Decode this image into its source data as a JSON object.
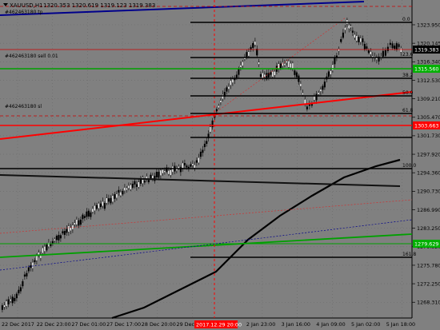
{
  "window": {
    "symbol_label": "XAUUSD,H1",
    "ohlc": "1320.353 1320.619 1319.123 1319.383"
  },
  "colors": {
    "background": "#808080",
    "bull_candle": "#ffffff",
    "bear_candle": "#000000",
    "grid": "#000000",
    "trend_blue": "#00008b",
    "trend_red": "#ff0000",
    "trend_green": "#00a000",
    "fib_line": "#000000",
    "ma_line": "#000000",
    "current_price_bg": "#000000",
    "green_tag_bg": "#00b000",
    "red_tag_bg": "#ff0000"
  },
  "orders": {
    "sell_label": "#462463180 sell 0.01",
    "sl_label": "#462463180 sl",
    "tp_label": "#462463180 tp"
  },
  "price_axis": {
    "ticks": [
      "1323.950",
      "1320.145",
      "1316.340",
      "1312.530",
      "1309.210",
      "1305.470",
      "1301.730",
      "1297.920",
      "1294.360",
      "1290.730",
      "1286.990",
      "1283.250",
      "1279.520",
      "1275.780",
      "1272.250",
      "1268.310"
    ],
    "current_price": "1319.383",
    "green_level": "1315.560",
    "red_level": "1303.663",
    "green_level_2": "1279.629",
    "min": 1266.0,
    "max": 1327.0
  },
  "time_axis": {
    "labels": [
      "22 Dec 2017",
      "22 Dec 23:00",
      "27 Dec 01:00",
      "27 Dec 17:00",
      "28 Dec 20:00",
      "29 Dec 12:00",
      "2017.12.29 20:00",
      "2 Jan 23:00",
      "3 Jan 16:00",
      "4 Jan 09:00",
      "5 Jan 02:00",
      "5 Jan 18:00"
    ],
    "highlight_index": 6
  },
  "fib_levels": [
    "0.0",
    "23.6",
    "38.2",
    "50.0",
    "61.8",
    "100.0",
    "161.8"
  ],
  "chart_data": {
    "type": "candlestick",
    "timeframe": "H1",
    "x": [
      "22 Dec 2017",
      "22 Dec 23:00",
      "27 Dec 01:00",
      "27 Dec 17:00",
      "28 Dec 20:00",
      "29 Dec 12:00",
      "2017.12.29 20:00",
      "2 Jan 23:00",
      "3 Jan 16:00",
      "4 Jan 09:00",
      "5 Jan 02:00",
      "5 Jan 18:00"
    ],
    "y_approx_close": [
      1268.3,
      1280.5,
      1285.0,
      1290.0,
      1293.0,
      1295.0,
      1305.0,
      1318.0,
      1312.0,
      1322.0,
      1320.0,
      1319.4
    ],
    "ylim": [
      1266.0,
      1327.0
    ]
  }
}
